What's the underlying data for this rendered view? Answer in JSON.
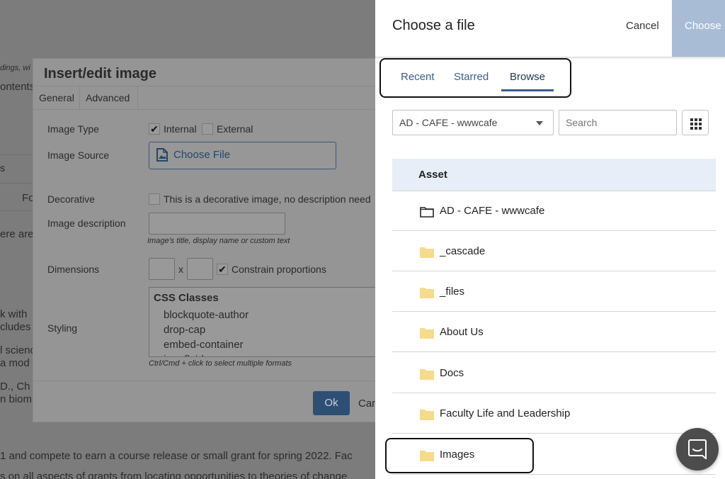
{
  "background_page": {
    "fragments": {
      "f1": "dings, wi",
      "f2": "ontents",
      "f3": "s",
      "f4": "Fo",
      "f5": "ere are",
      "f6": "k with",
      "f7": "cludes",
      "f8": "l scienc",
      "f9": "a mod",
      "f10": "D., Ch",
      "f11": "n biom",
      "f12": "1 and compete to earn a course release or small grant for spring 2022. Fac",
      "f13": "s on all aspects of grants from locating opportunities to theories of change"
    }
  },
  "dialog": {
    "title": "Insert/edit image",
    "tabs": [
      "General",
      "Advanced"
    ],
    "image_type_label": "Image Type",
    "internal_label": "Internal",
    "external_label": "External",
    "image_source_label": "Image Source",
    "choose_file_label": "Choose File",
    "decorative_label": "Decorative",
    "decorative_checkbox_label": "This is a decorative image, no description need",
    "image_description_label": "Image description",
    "image_description_help": "Image's title, display name or custom text",
    "dimensions_label": "Dimensions",
    "dimensions_x": "x",
    "constrain_label": "Constrain proportions",
    "styling_label": "Styling",
    "styling_header": "CSS Classes",
    "styling_options": [
      "blockquote-author",
      "drop-cap",
      "embed-container",
      "img-fluid"
    ],
    "styling_help": "Ctrl/Cmd + click to select multiple formats",
    "ok_label": "Ok",
    "cancel_label": "Can"
  },
  "panel": {
    "title": "Choose a file",
    "cancel_label": "Cancel",
    "choose_label": "Choose",
    "tabs": [
      "Recent",
      "Starred",
      "Browse"
    ],
    "active_tab": "Browse",
    "site_select_value": "AD - CAFE - wwwcafe",
    "search_placeholder": "Search",
    "column_header": "Asset",
    "rows": [
      {
        "label": "AD - CAFE - wwwcafe",
        "icon": "folder-outline-icon"
      },
      {
        "label": "_cascade",
        "icon": "folder-icon"
      },
      {
        "label": "_files",
        "icon": "folder-icon"
      },
      {
        "label": "About Us",
        "icon": "folder-icon"
      },
      {
        "label": "Docs",
        "icon": "folder-icon"
      },
      {
        "label": "Faculty Life and Leadership",
        "icon": "folder-icon"
      },
      {
        "label": "Images",
        "icon": "folder-icon"
      }
    ],
    "colors": {
      "accent": "#3a5f8a",
      "choose_button": "#a8bcd6",
      "header_row": "#e7eef7",
      "folder": "#f5dc8c"
    }
  }
}
